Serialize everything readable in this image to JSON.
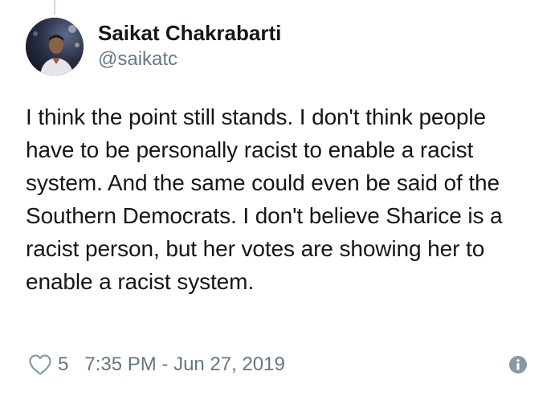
{
  "tweet": {
    "author": {
      "display_name": "Saikat Chakrabarti",
      "handle": "@saikatc"
    },
    "text": "I think the point still stands. I don't think people have to be personally racist to enable a racist system. And the same could even be said of the Southern Democrats. I don't believe Sharice is a racist person, but her votes are showing her to enable a racist system.",
    "likes": "5",
    "timestamp": "7:35 PM - Jun 27, 2019"
  },
  "icons": {
    "like": "heart-outline-icon",
    "info": "info-icon"
  },
  "colors": {
    "primary_text": "#14171a",
    "secondary_text": "#657786",
    "thread_line": "#ccd6dd"
  }
}
